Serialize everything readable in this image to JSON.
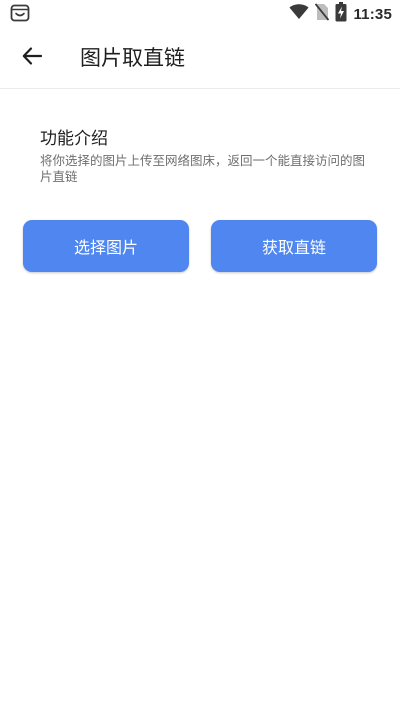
{
  "status_bar": {
    "time": "11:35",
    "icons": [
      "app-notification-icon",
      "wifi-icon",
      "no-sim-icon",
      "battery-charging-icon"
    ]
  },
  "app_bar": {
    "back_icon": "arrow-left-icon",
    "title": "图片取直链"
  },
  "intro": {
    "title": "功能介绍",
    "description": "将你选择的图片上传至网络图床，返回一个能直接访问的图片直链"
  },
  "actions": {
    "select_image_label": "选择图片",
    "get_link_label": "获取直链"
  },
  "colors": {
    "accent": "#4f86f0",
    "background": "#ffffff",
    "divider": "#ececec",
    "secondary_text": "#6f6f6f"
  }
}
